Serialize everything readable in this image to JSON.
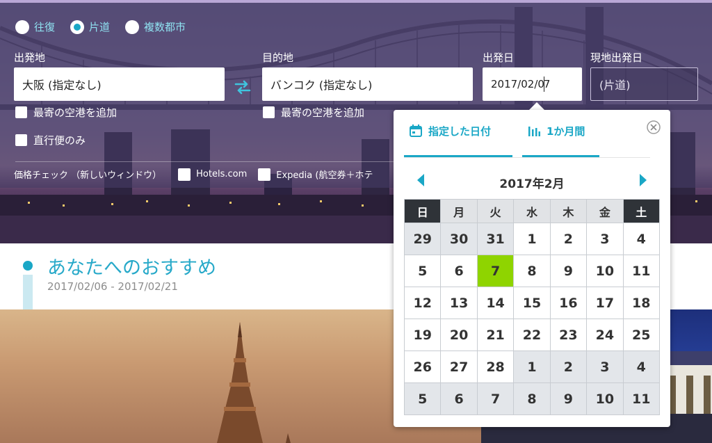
{
  "trip_type": {
    "options": [
      "往復",
      "片道",
      "複数都市"
    ],
    "selected_index": 1
  },
  "origin": {
    "label": "出発地",
    "value": "大阪 (指定なし)",
    "nearby_label": "最寄の空港を追加"
  },
  "destination": {
    "label": "目的地",
    "value": "バンコク (指定なし)",
    "nearby_label": "最寄の空港を追加"
  },
  "depart_date": {
    "label": "出発日",
    "value_before_caret": "2017/02/0",
    "value_after_caret": "7"
  },
  "local_depart_date": {
    "label": "現地出発日",
    "placeholder": "(片道)"
  },
  "direct_only": {
    "label": "直行便のみ"
  },
  "price_check": {
    "label": "価格チェック （新しいウィンドウ）",
    "options": [
      "Hotels.com",
      "Expedia (航空券＋ホテ"
    ]
  },
  "recommendations": {
    "title": "あなたへのおすすめ",
    "date_range": "2017/02/06 - 2017/02/21"
  },
  "date_picker": {
    "tabs": [
      "指定した日付",
      "1か月間"
    ],
    "active_tab": 0,
    "month_title": "2017年2月",
    "weekdays": [
      "日",
      "月",
      "火",
      "水",
      "木",
      "金",
      "土"
    ],
    "weeks": [
      [
        "29",
        "30",
        "31",
        "1",
        "2",
        "3",
        "4"
      ],
      [
        "5",
        "6",
        "7",
        "8",
        "9",
        "10",
        "11"
      ],
      [
        "12",
        "13",
        "14",
        "15",
        "16",
        "17",
        "18"
      ],
      [
        "19",
        "20",
        "21",
        "22",
        "23",
        "24",
        "25"
      ],
      [
        "26",
        "27",
        "28",
        "1",
        "2",
        "3",
        "4"
      ],
      [
        "5",
        "6",
        "7",
        "8",
        "9",
        "10",
        "11"
      ]
    ],
    "selected_day": "7",
    "colors": {
      "selected": "#8fd400",
      "accent": "#1aa7c6",
      "outside_month": "#e3e6ea"
    }
  }
}
